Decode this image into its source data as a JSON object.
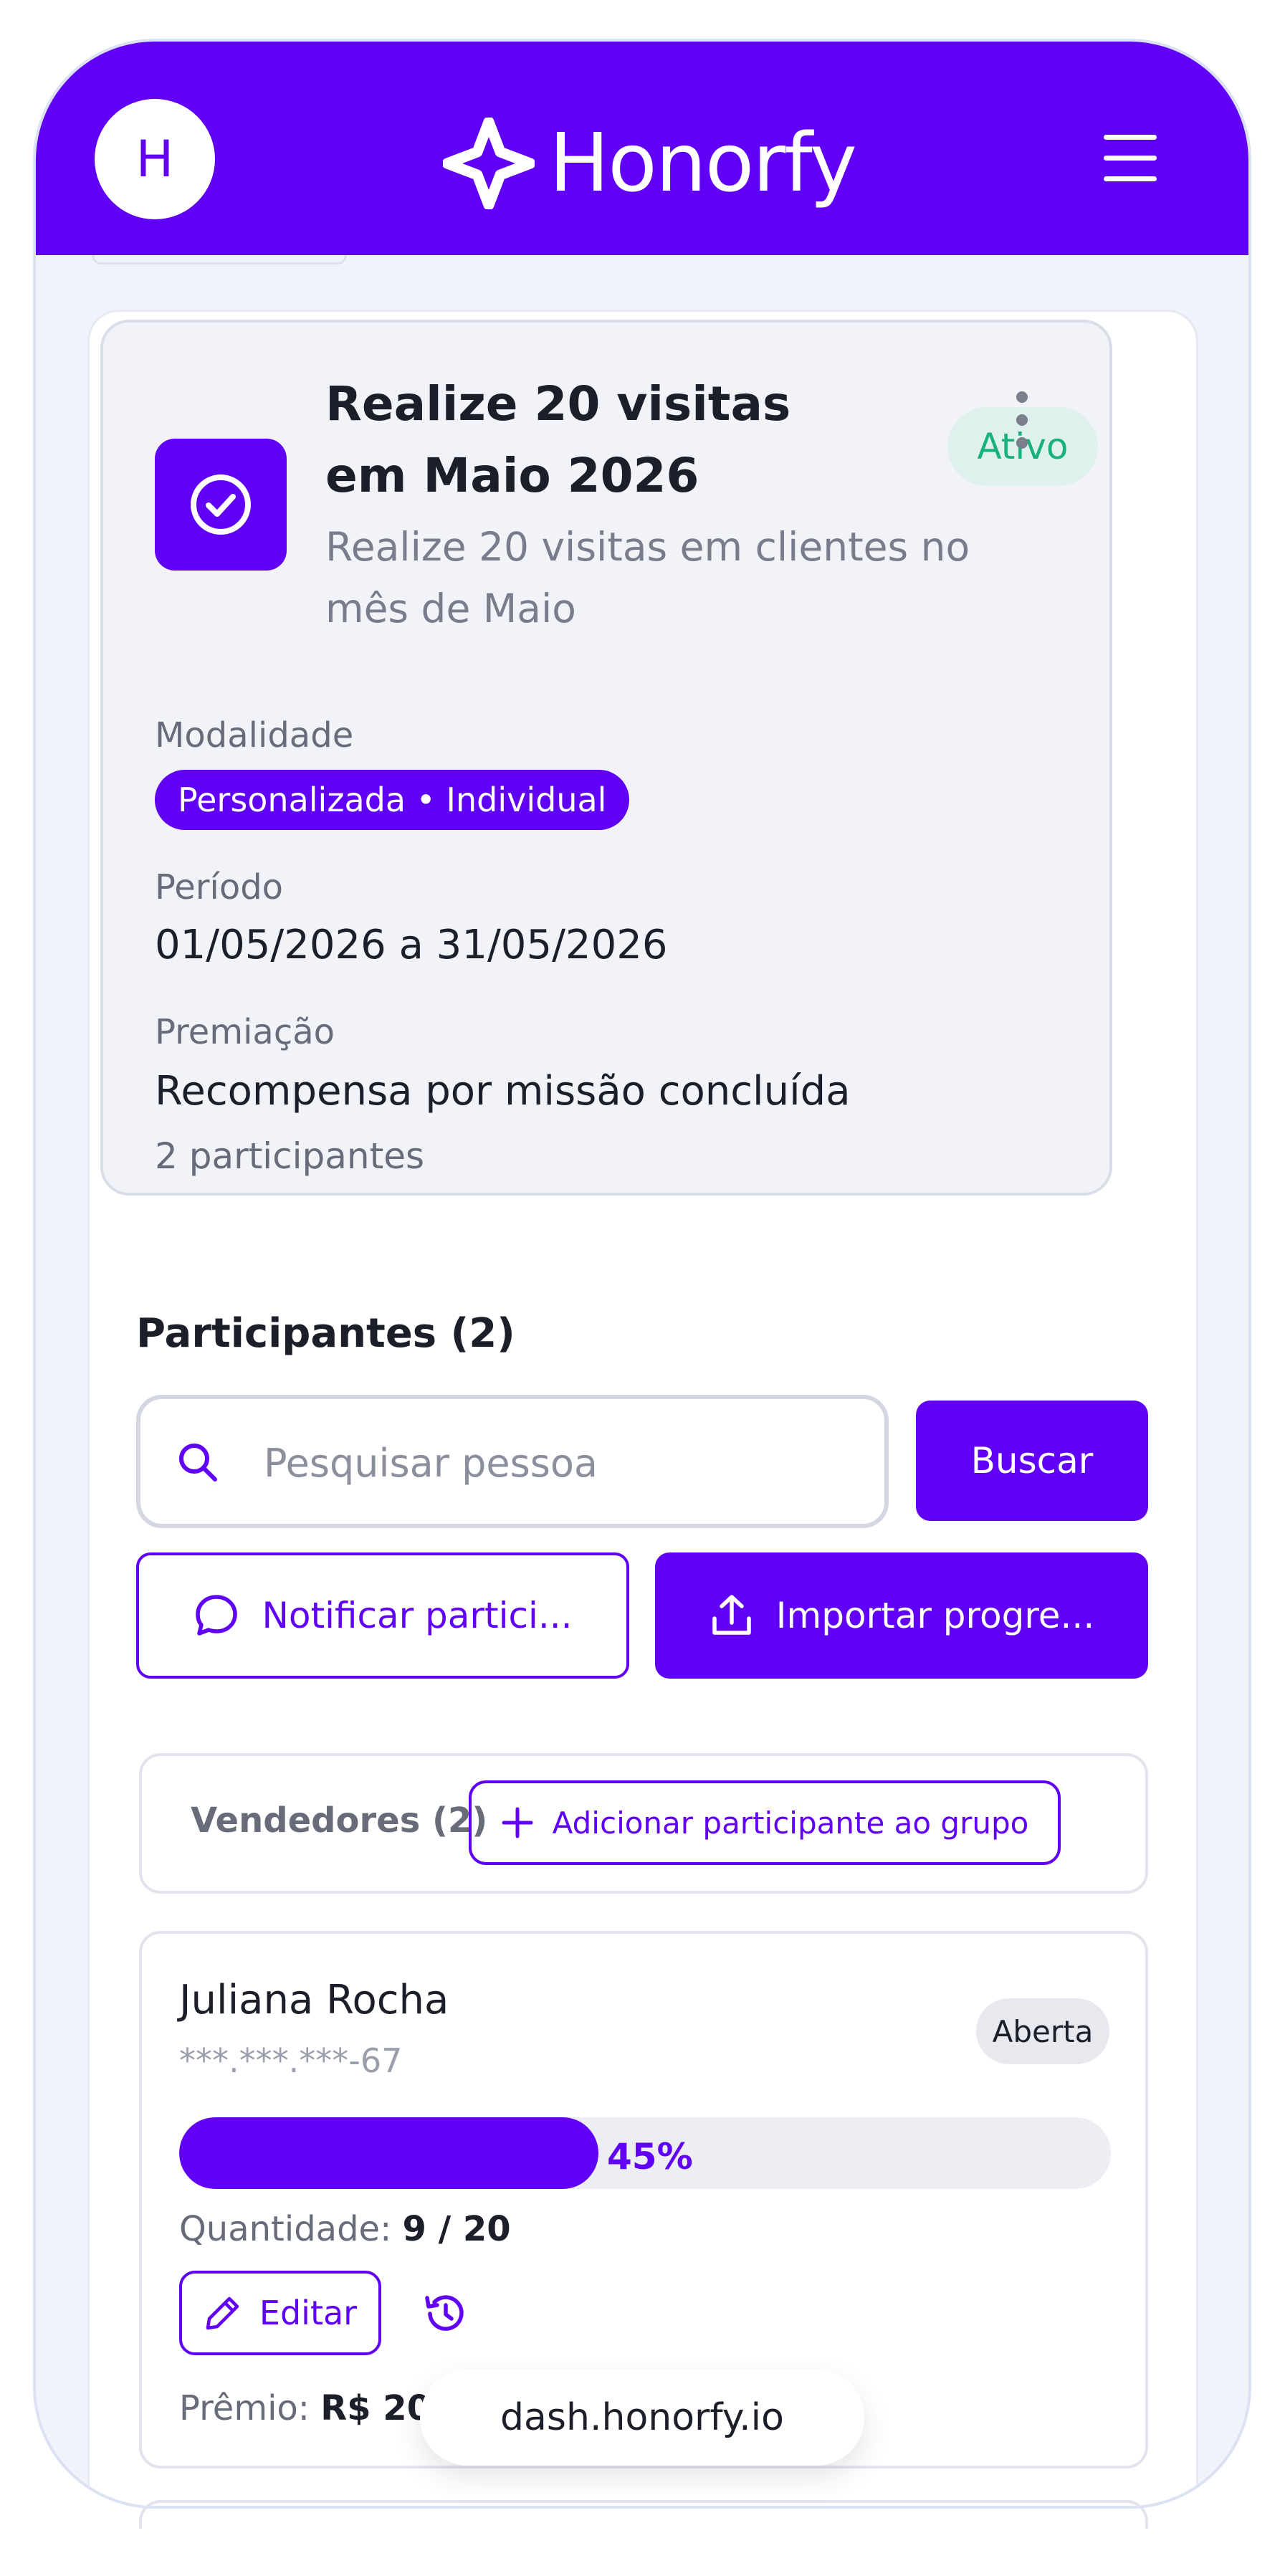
{
  "header": {
    "avatar_initial": "H",
    "brand_name": "Honorfy",
    "brand_color": "#6000f5",
    "menu_icon": "hamburger-menu-icon"
  },
  "mission": {
    "icon": "check-circle-icon",
    "title": "Realize 20 visitas em Maio 2026",
    "description": "Realize 20 visitas em clientes no mês de Maio",
    "status": "Ativo",
    "status_color": "#18b07d",
    "modality_label": "Modalidade",
    "modality_value": "Personalizada • Individual",
    "period_label": "Período",
    "period_value": "01/05/2026 a 31/05/2026",
    "prize_label": "Premiação",
    "prize_value": "Recompensa por missão concluída",
    "participants_count": "2 participantes"
  },
  "participants": {
    "title": "Participantes (2)",
    "search_placeholder": "Pesquisar pessoa",
    "search_value": "",
    "search_button": "Buscar",
    "notify_button": "Notificar partici...",
    "import_button": "Importar progre...",
    "group_label": "Vendedores (2)",
    "add_button": "Adicionar participante ao grupo",
    "items": [
      {
        "name": "Juliana Rocha",
        "document": "***.***.***-67",
        "status": "Aberta",
        "progress_percent": 45,
        "progress_label": "45%",
        "quantity_label": "Quantidade:",
        "quantity_value": "9 / 20",
        "edit_button": "Editar",
        "prize_label": "Prêmio:",
        "prize_value": "R$ 200"
      }
    ]
  },
  "browser": {
    "url": "dash.honorfy.io"
  }
}
